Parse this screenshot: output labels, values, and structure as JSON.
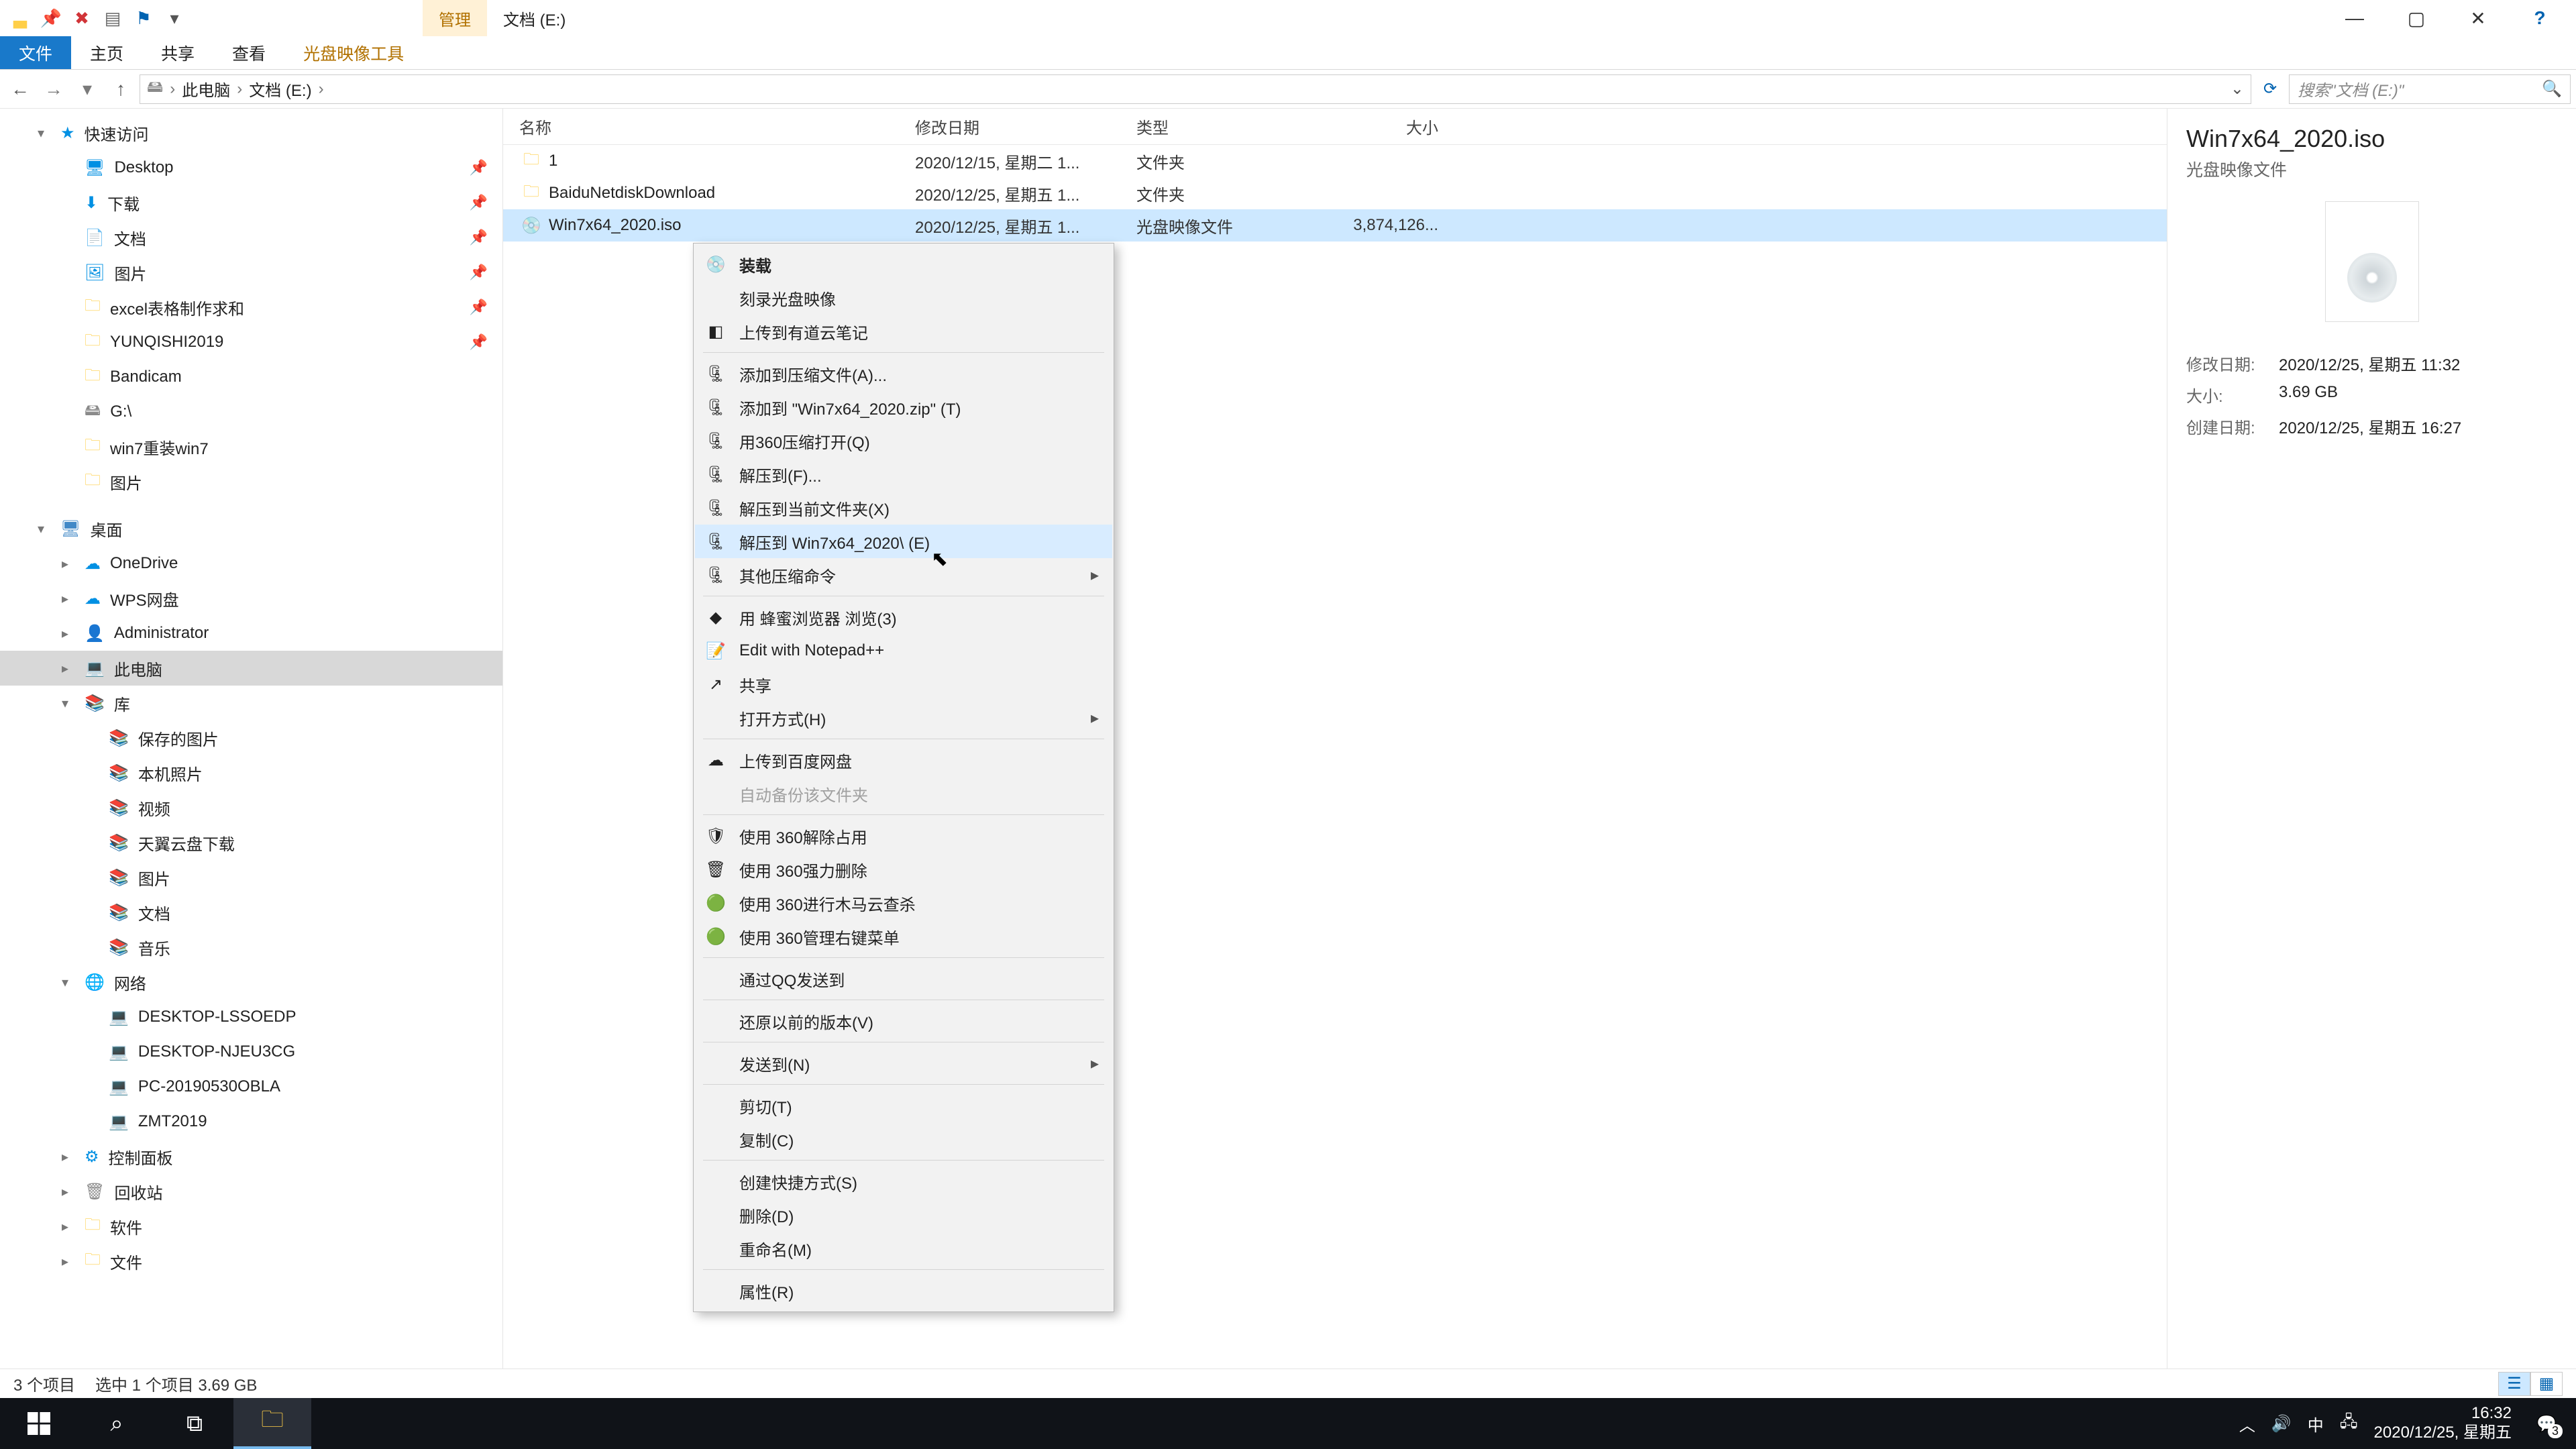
{
  "titlebar": {
    "qat_icons": [
      "explorer",
      "pin",
      "close",
      "new",
      "dropdown"
    ],
    "drive_title": "文档 (E:)",
    "manage_tab": "管理"
  },
  "window_controls": {
    "min": "—",
    "max": "▢",
    "close": "✕",
    "help": "?"
  },
  "ribbon": {
    "file": "文件",
    "tabs": [
      "主页",
      "共享",
      "查看",
      "光盘映像工具"
    ]
  },
  "breadcrumb": {
    "root": "此电脑",
    "drive": "文档 (E:)",
    "search_placeholder": "搜索\"文档 (E:)\""
  },
  "tree": [
    {
      "type": "node",
      "indent": 1,
      "icon": "star",
      "iconcls": "ico-blue",
      "label": "快速访问",
      "expander": "▾"
    },
    {
      "type": "node",
      "indent": 2,
      "icon": "monitor",
      "iconcls": "ico-blue",
      "label": "Desktop",
      "pin": true
    },
    {
      "type": "node",
      "indent": 2,
      "icon": "download",
      "iconcls": "ico-blue",
      "label": "下载",
      "pin": true
    },
    {
      "type": "node",
      "indent": 2,
      "icon": "doc",
      "iconcls": "ico-blue",
      "label": "文档",
      "pin": true
    },
    {
      "type": "node",
      "indent": 2,
      "icon": "pic",
      "iconcls": "ico-blue",
      "label": "图片",
      "pin": true
    },
    {
      "type": "node",
      "indent": 2,
      "icon": "folder",
      "iconcls": "ico-folder",
      "label": "excel表格制作求和",
      "pin": true
    },
    {
      "type": "node",
      "indent": 2,
      "icon": "folder",
      "iconcls": "ico-folder",
      "label": "YUNQISHI2019",
      "pin": true
    },
    {
      "type": "node",
      "indent": 2,
      "icon": "folder",
      "iconcls": "ico-folder",
      "label": "Bandicam"
    },
    {
      "type": "node",
      "indent": 2,
      "icon": "drive",
      "iconcls": "ico-grey",
      "label": "G:\\"
    },
    {
      "type": "node",
      "indent": 2,
      "icon": "folder",
      "iconcls": "ico-folder",
      "label": "win7重装win7"
    },
    {
      "type": "node",
      "indent": 2,
      "icon": "folder",
      "iconcls": "ico-folder",
      "label": "图片"
    },
    {
      "type": "spacer"
    },
    {
      "type": "node",
      "indent": 1,
      "icon": "monitor",
      "iconcls": "ico-monitor",
      "label": "桌面",
      "expander": "▾"
    },
    {
      "type": "node",
      "indent": 2,
      "icon": "cloud",
      "iconcls": "ico-blue",
      "label": "OneDrive",
      "expander": "▸"
    },
    {
      "type": "node",
      "indent": 2,
      "icon": "cloud",
      "iconcls": "ico-blue",
      "label": "WPS网盘",
      "expander": "▸"
    },
    {
      "type": "node",
      "indent": 2,
      "icon": "user",
      "iconcls": "ico-grey",
      "label": "Administrator",
      "expander": "▸"
    },
    {
      "type": "node",
      "indent": 2,
      "icon": "pc",
      "iconcls": "ico-dark",
      "label": "此电脑",
      "expander": "▸",
      "selected": true
    },
    {
      "type": "node",
      "indent": 2,
      "icon": "lib",
      "iconcls": "ico-blue",
      "label": "库",
      "expander": "▾"
    },
    {
      "type": "node",
      "indent": 3,
      "icon": "lib",
      "iconcls": "ico-blue",
      "label": "保存的图片"
    },
    {
      "type": "node",
      "indent": 3,
      "icon": "lib",
      "iconcls": "ico-blue",
      "label": "本机照片"
    },
    {
      "type": "node",
      "indent": 3,
      "icon": "lib",
      "iconcls": "ico-blue",
      "label": "视频"
    },
    {
      "type": "node",
      "indent": 3,
      "icon": "lib",
      "iconcls": "ico-blue",
      "label": "天翼云盘下载"
    },
    {
      "type": "node",
      "indent": 3,
      "icon": "lib",
      "iconcls": "ico-blue",
      "label": "图片"
    },
    {
      "type": "node",
      "indent": 3,
      "icon": "lib",
      "iconcls": "ico-blue",
      "label": "文档"
    },
    {
      "type": "node",
      "indent": 3,
      "icon": "lib",
      "iconcls": "ico-blue",
      "label": "音乐"
    },
    {
      "type": "node",
      "indent": 2,
      "icon": "net",
      "iconcls": "ico-blue",
      "label": "网络",
      "expander": "▾"
    },
    {
      "type": "node",
      "indent": 3,
      "icon": "pc",
      "iconcls": "ico-dark",
      "label": "DESKTOP-LSSOEDP"
    },
    {
      "type": "node",
      "indent": 3,
      "icon": "pc",
      "iconcls": "ico-dark",
      "label": "DESKTOP-NJEU3CG"
    },
    {
      "type": "node",
      "indent": 3,
      "icon": "pc",
      "iconcls": "ico-dark",
      "label": "PC-20190530OBLA"
    },
    {
      "type": "node",
      "indent": 3,
      "icon": "pc",
      "iconcls": "ico-dark",
      "label": "ZMT2019"
    },
    {
      "type": "node",
      "indent": 2,
      "icon": "panel",
      "iconcls": "ico-blue",
      "label": "控制面板",
      "expander": "▸"
    },
    {
      "type": "node",
      "indent": 2,
      "icon": "bin",
      "iconcls": "ico-grey",
      "label": "回收站",
      "expander": "▸"
    },
    {
      "type": "node",
      "indent": 2,
      "icon": "folder",
      "iconcls": "ico-folder",
      "label": "软件",
      "expander": "▸"
    },
    {
      "type": "node",
      "indent": 2,
      "icon": "folder",
      "iconcls": "ico-folder",
      "label": "文件",
      "expander": "▸"
    }
  ],
  "columns": {
    "name": "名称",
    "date": "修改日期",
    "type": "类型",
    "size": "大小"
  },
  "files": [
    {
      "icon": "folder",
      "name": "1",
      "date": "2020/12/15, 星期二 1...",
      "type": "文件夹",
      "size": ""
    },
    {
      "icon": "folder",
      "name": "BaiduNetdiskDownload",
      "date": "2020/12/25, 星期五 1...",
      "type": "文件夹",
      "size": ""
    },
    {
      "icon": "iso",
      "name": "Win7x64_2020.iso",
      "date": "2020/12/25, 星期五 1...",
      "type": "光盘映像文件",
      "size": "3,874,126...",
      "selected": true
    }
  ],
  "context_menu": [
    {
      "label": "装载",
      "icon": "disc",
      "bold": true
    },
    {
      "label": "刻录光盘映像"
    },
    {
      "label": "上传到有道云笔记",
      "icon": "blue"
    },
    {
      "sep": true
    },
    {
      "label": "添加到压缩文件(A)...",
      "icon": "zip"
    },
    {
      "label": "添加到 \"Win7x64_2020.zip\" (T)",
      "icon": "zip"
    },
    {
      "label": "用360压缩打开(Q)",
      "icon": "zip"
    },
    {
      "label": "解压到(F)...",
      "icon": "zip"
    },
    {
      "label": "解压到当前文件夹(X)",
      "icon": "zip"
    },
    {
      "label": "解压到 Win7x64_2020\\ (E)",
      "icon": "zip",
      "hover": true
    },
    {
      "label": "其他压缩命令",
      "icon": "zip",
      "submenu": true
    },
    {
      "sep": true
    },
    {
      "label": "用 蜂蜜浏览器 浏览(3)",
      "icon": "green"
    },
    {
      "label": "Edit with Notepad++",
      "icon": "npp"
    },
    {
      "label": "共享",
      "icon": "share"
    },
    {
      "label": "打开方式(H)",
      "submenu": true
    },
    {
      "sep": true
    },
    {
      "label": "上传到百度网盘",
      "icon": "baidu"
    },
    {
      "label": "自动备份该文件夹",
      "disabled": true
    },
    {
      "sep": true
    },
    {
      "label": "使用 360解除占用",
      "icon": "s1"
    },
    {
      "label": "使用 360强力删除",
      "icon": "s2"
    },
    {
      "label": "使用 360进行木马云查杀",
      "icon": "s3"
    },
    {
      "label": "使用 360管理右键菜单",
      "icon": "s3"
    },
    {
      "sep": true
    },
    {
      "label": "通过QQ发送到"
    },
    {
      "sep": true
    },
    {
      "label": "还原以前的版本(V)"
    },
    {
      "sep": true
    },
    {
      "label": "发送到(N)",
      "submenu": true
    },
    {
      "sep": true
    },
    {
      "label": "剪切(T)"
    },
    {
      "label": "复制(C)"
    },
    {
      "sep": true
    },
    {
      "label": "创建快捷方式(S)"
    },
    {
      "label": "删除(D)"
    },
    {
      "label": "重命名(M)"
    },
    {
      "sep": true
    },
    {
      "label": "属性(R)"
    }
  ],
  "details": {
    "title": "Win7x64_2020.iso",
    "subtitle": "光盘映像文件",
    "props": [
      {
        "k": "修改日期:",
        "v": "2020/12/25, 星期五 11:32"
      },
      {
        "k": "大小:",
        "v": "3.69 GB"
      },
      {
        "k": "创建日期:",
        "v": "2020/12/25, 星期五 16:27"
      }
    ]
  },
  "status": {
    "items": "3 个项目",
    "selection": "选中 1 个项目  3.69 GB"
  },
  "taskbar": {
    "ime": "中",
    "time": "16:32",
    "date": "2020/12/25, 星期五",
    "notif_count": "3"
  }
}
